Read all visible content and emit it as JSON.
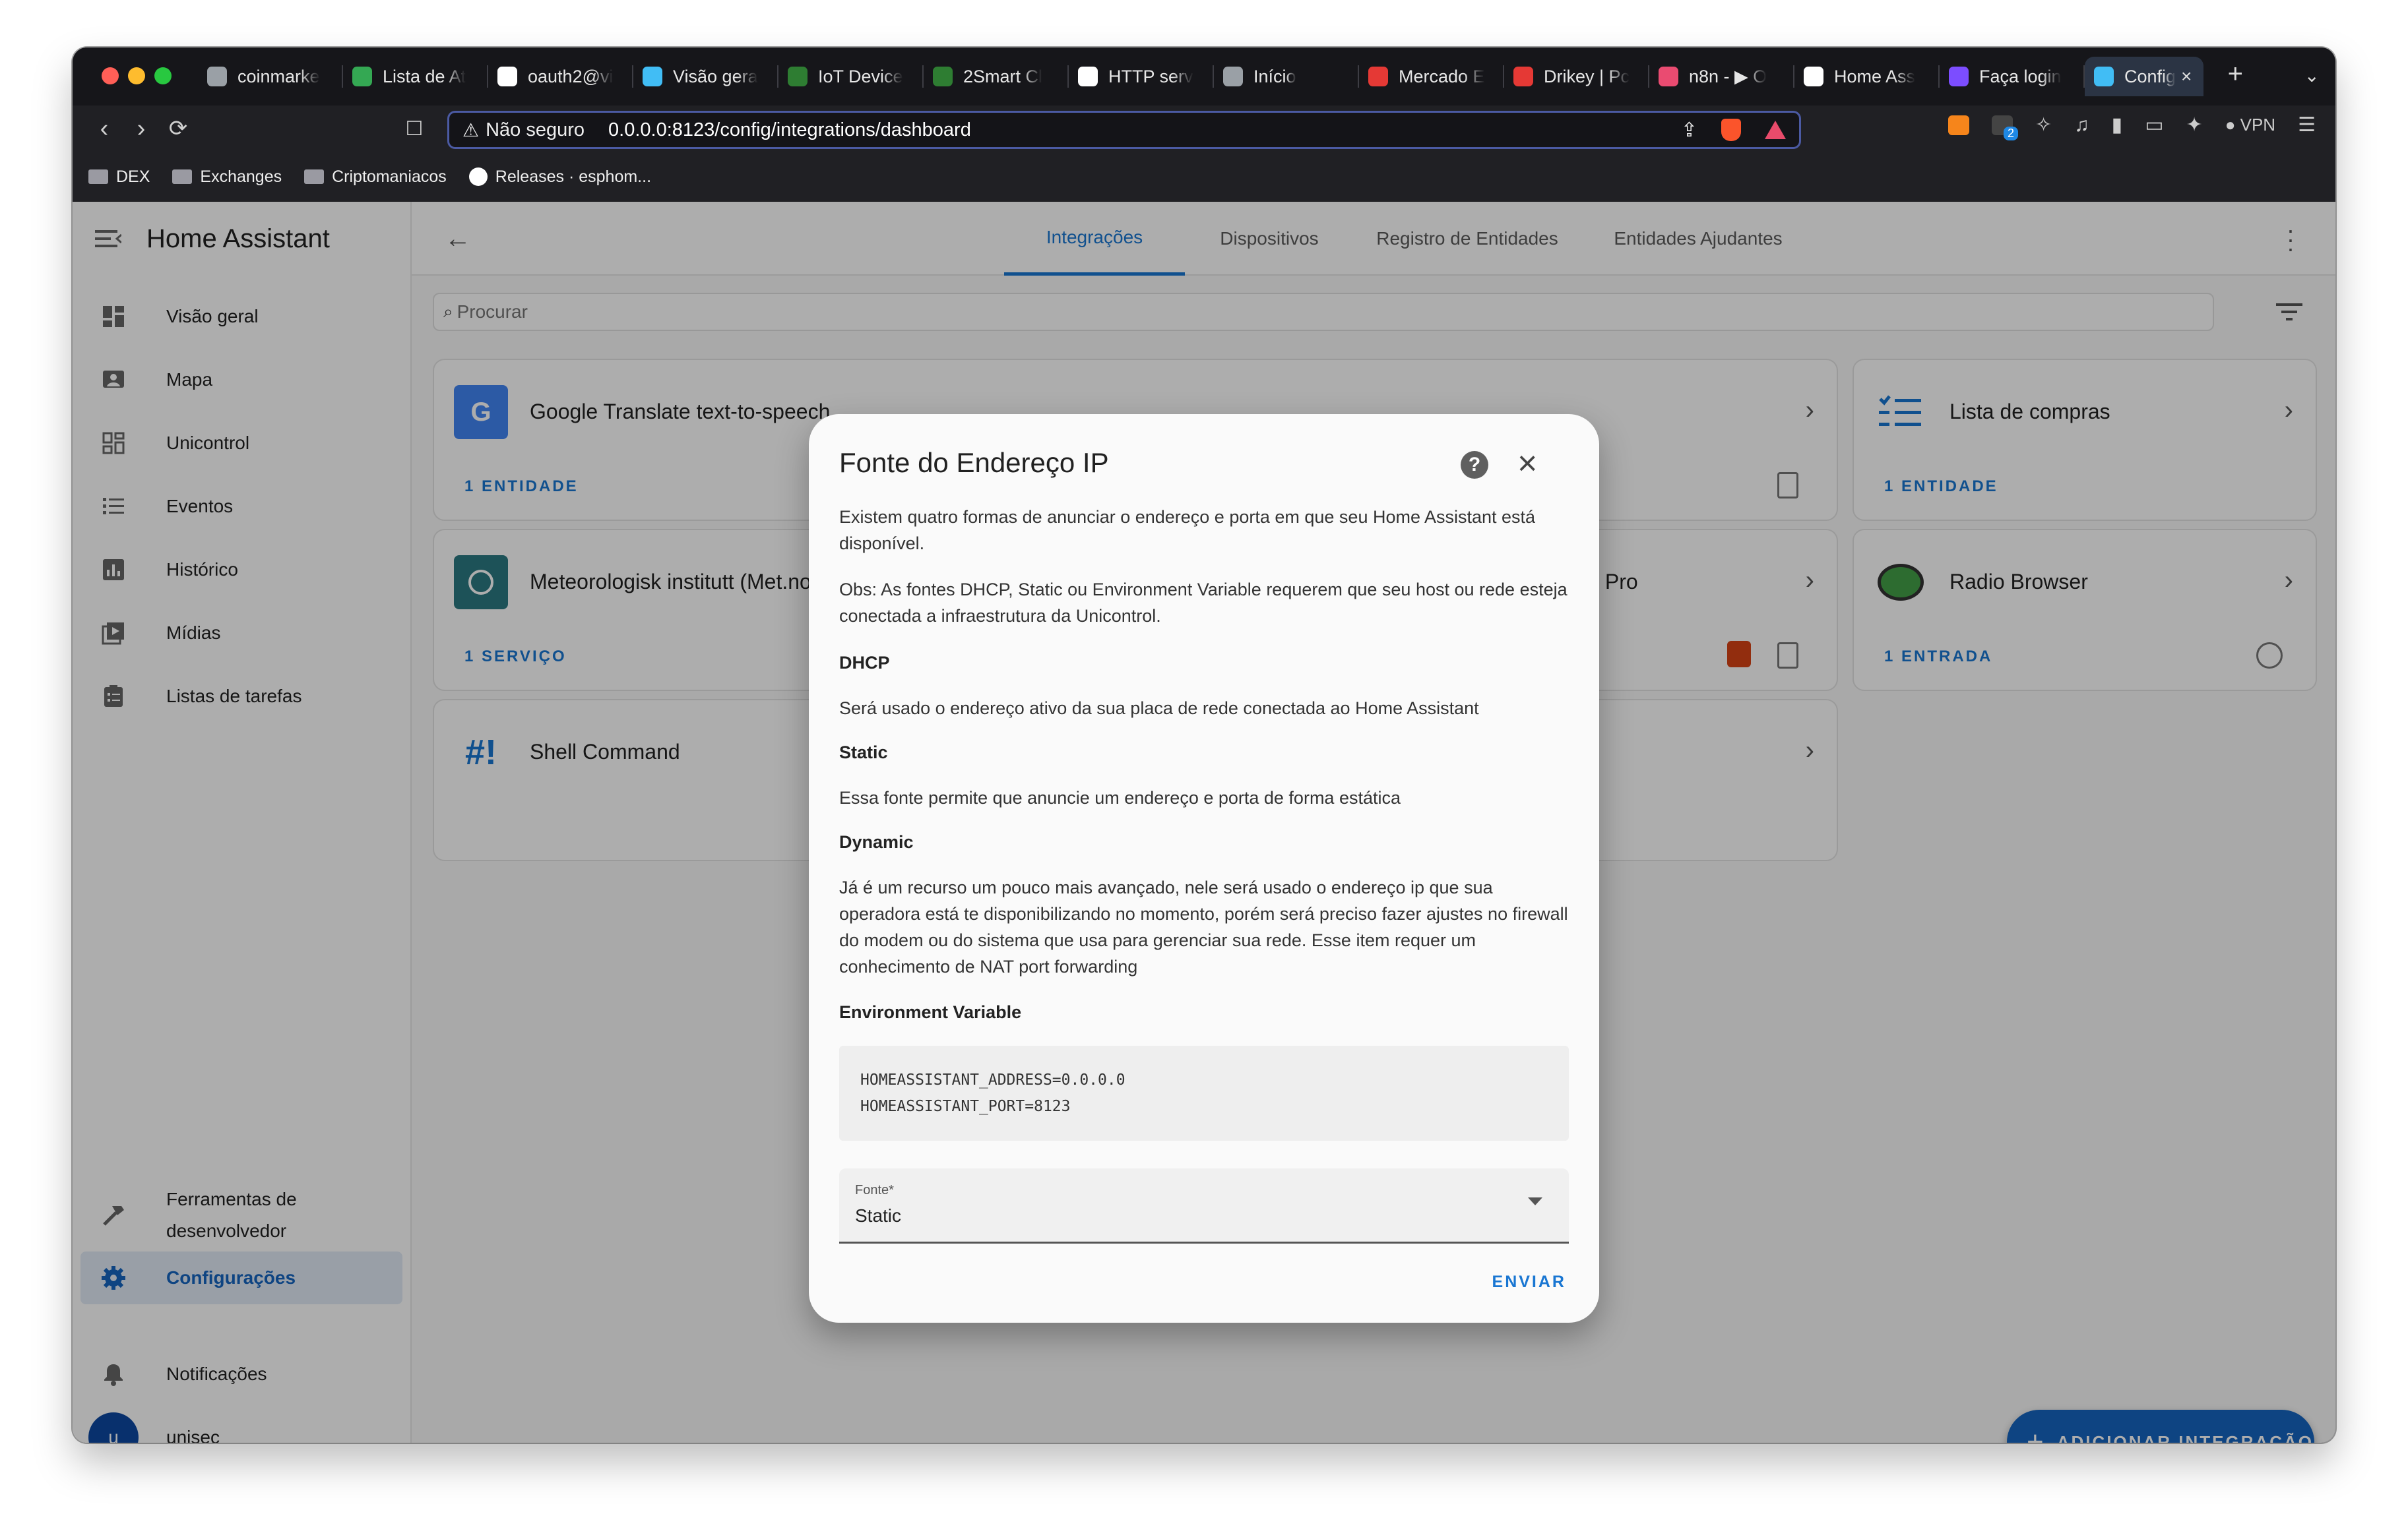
{
  "browser": {
    "tabs": [
      {
        "label": "coinmarke",
        "icon": "globe-icon",
        "color": "#9aa0a6"
      },
      {
        "label": "Lista de At",
        "icon": "sheets-icon",
        "color": "#34a853"
      },
      {
        "label": "oauth2@vi",
        "icon": "github-icon",
        "color": "#ffffff"
      },
      {
        "label": "Visão gera",
        "icon": "home-assistant-icon",
        "color": "#41bdf5"
      },
      {
        "label": "IoT Device",
        "icon": "iot-icon",
        "color": "#2e7d32"
      },
      {
        "label": "2Smart Cl",
        "icon": "iot-icon",
        "color": "#2e7d32"
      },
      {
        "label": "HTTP serv",
        "icon": "github-icon",
        "color": "#ffffff"
      },
      {
        "label": "Início",
        "icon": "circle-icon",
        "color": "#9aa0a6"
      },
      {
        "label": "Mercado E",
        "icon": "mercado-icon",
        "color": "#e53935"
      },
      {
        "label": "Drikey | Pc",
        "icon": "drikey-icon",
        "color": "#e53935"
      },
      {
        "label": "n8n - ▶ O",
        "icon": "n8n-icon",
        "color": "#ea4b71"
      },
      {
        "label": "Home Ass",
        "icon": "github-icon",
        "color": "#ffffff"
      },
      {
        "label": "Faça login",
        "icon": "login-icon",
        "color": "#7c4dff"
      }
    ],
    "active_tab": {
      "label": "Config",
      "icon": "home-assistant-icon",
      "color": "#41bdf5"
    },
    "security": "Não seguro",
    "url": "0.0.0.0:8123/config/integrations/dashboard",
    "vpn_label": "VPN",
    "ext_badge": "2",
    "bookmarks": [
      "DEX",
      "Exchanges",
      "Criptomaniacos",
      "Releases · esphom..."
    ]
  },
  "sidebar": {
    "title": "Home Assistant",
    "items": [
      {
        "label": "Visão geral",
        "icon": "dashboard-icon"
      },
      {
        "label": "Mapa",
        "icon": "map-icon"
      },
      {
        "label": "Unicontrol",
        "icon": "grid-icon"
      },
      {
        "label": "Eventos",
        "icon": "list-icon"
      },
      {
        "label": "Histórico",
        "icon": "chart-icon"
      },
      {
        "label": "Mídias",
        "icon": "media-icon"
      },
      {
        "label": "Listas de tarefas",
        "icon": "clipboard-icon"
      }
    ],
    "dev_tools": "Ferramentas de desenvolvedor",
    "settings": "Configurações",
    "notifications": "Notificações",
    "user": "unisec",
    "user_initial": "u"
  },
  "header": {
    "tabs": [
      "Integrações",
      "Dispositivos",
      "Registro de Entidades",
      "Entidades Ajudantes"
    ]
  },
  "search": {
    "placeholder": "Procurar"
  },
  "cards": [
    {
      "name": "Google Translate text-to-speech",
      "count": "1 ENTIDADE"
    },
    {
      "name": "Meteorologisk institutt (Met.no)",
      "count": "1 SERVIÇO"
    },
    {
      "name": "Shell Command",
      "count": ""
    },
    {
      "name": "Lista de compras",
      "count": "1 ENTIDADE"
    },
    {
      "name": "Radio Browser",
      "count": "1 ENTRADA"
    },
    {
      "name": "s Pro",
      "count": ""
    }
  ],
  "dialog": {
    "title": "Fonte do Endereço IP",
    "intro": "Existem quatro formas de anunciar o endereço e porta em que seu Home Assistant está disponível.",
    "note": "Obs: As fontes DHCP, Static ou Environment Variable requerem que seu host ou rede esteja conectada a infraestrutura da Unicontrol.",
    "dhcp_head": "DHCP",
    "dhcp_text": "Será usado o endereço ativo da sua placa de rede conectada ao Home Assistant",
    "static_head": "Static",
    "static_text": "Essa fonte permite que anuncie um endereço e porta de forma estática",
    "dynamic_head": "Dynamic",
    "dynamic_text": "Já é um recurso um pouco mais avançado, nele será usado o endereço ip que sua operadora está te disponibilizando no momento, porém será preciso fazer ajustes no firewall do modem ou do sistema que usa para gerenciar sua rede. Esse item requer um conhecimento de NAT port forwarding",
    "env_head": "Environment Variable",
    "code_line1": "HOMEASSISTANT_ADDRESS=0.0.0.0",
    "code_line2": "HOMEASSISTANT_PORT=8123",
    "select_label": "Fonte*",
    "select_value": "Static",
    "submit": "ENVIAR"
  },
  "fab": {
    "label": "ADICIONAR INTEGRAÇÃO"
  },
  "colors": {
    "accent": "#1976d2",
    "fab": "#1565c0",
    "selected_bg": "#e2ebf7"
  }
}
